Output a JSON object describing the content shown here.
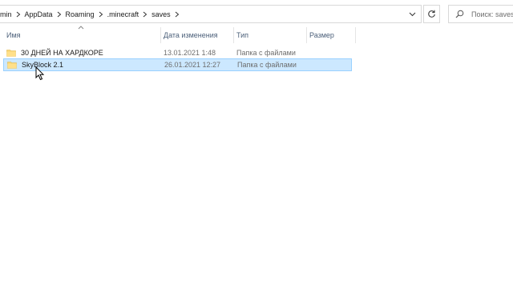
{
  "address_bar": {
    "crumbs": [
      "min",
      "AppData",
      "Roaming",
      ".minecraft",
      "saves"
    ]
  },
  "search": {
    "placeholder": "Поиск: saves"
  },
  "columns": {
    "name": "Имя",
    "date": "Дата изменения",
    "type": "Тип",
    "size": "Размер"
  },
  "files": [
    {
      "name": "30 ДНЕЙ НА ХАРДКОРЕ",
      "date": "13.01.2021 1:48",
      "type": "Папка с файлами",
      "selected": false
    },
    {
      "name": "SkyBlock 2.1",
      "date": "26.01.2021 12:27",
      "type": "Папка с файлами",
      "selected": true
    }
  ],
  "colors": {
    "selection_bg": "#cce8ff",
    "selection_border": "#99d1ff",
    "folder": "#f8d775",
    "header_text": "#4c607a"
  },
  "icons": [
    "chevron-right-icon",
    "chevron-down-icon",
    "refresh-icon",
    "search-icon",
    "folder-icon",
    "sort-up-icon",
    "mouse-cursor-icon"
  ]
}
